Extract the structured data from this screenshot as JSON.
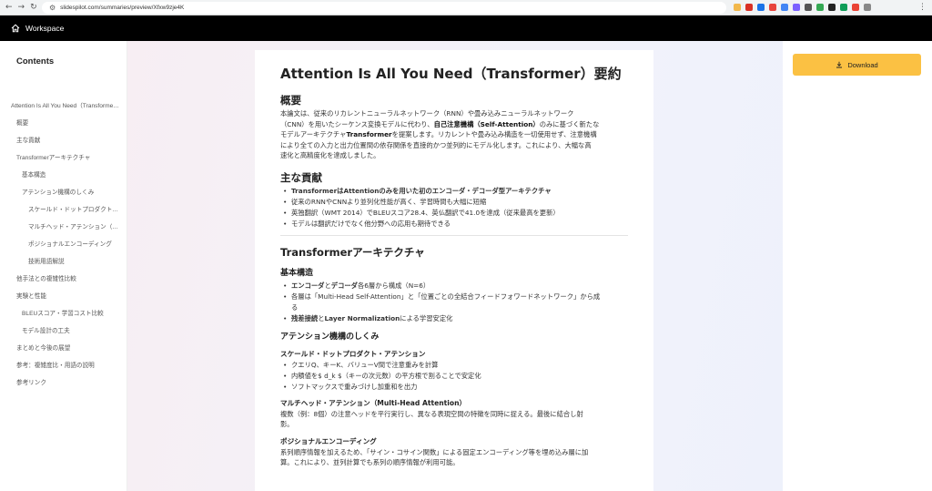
{
  "browser": {
    "url": "slidespilot.com/summaries/preview/Xfxw9zje4K"
  },
  "colors": {
    "appbar": "#000000",
    "download_button": "#fbc143"
  },
  "appbar": {
    "title": "Workspace"
  },
  "sidebar": {
    "heading": "Contents",
    "items": [
      {
        "label": "Attention Is All You Need（Transformer）要約",
        "level": 0
      },
      {
        "label": "概要",
        "level": 1
      },
      {
        "label": "主な貢献",
        "level": 1
      },
      {
        "label": "Transformerアーキテクチャ",
        "level": 1
      },
      {
        "label": "基本構造",
        "level": 2
      },
      {
        "label": "アテンション機構のしくみ",
        "level": 2
      },
      {
        "label": "スケールド・ドットプロダクト・アテンション",
        "level": 3
      },
      {
        "label": "マルチヘッド・アテンション（Multi-Head Attention）",
        "level": 3
      },
      {
        "label": "ポジショナルエンコーディング",
        "level": 3
      },
      {
        "label": "技術用語解説",
        "level": 3
      },
      {
        "label": "他手法との複雑性比較",
        "level": 1
      },
      {
        "label": "実験と性能",
        "level": 1
      },
      {
        "label": "BLEUスコア・学習コスト比較",
        "level": 2
      },
      {
        "label": "モデル設計の工夫",
        "level": 2
      },
      {
        "label": "まとめと今後の展望",
        "level": 1
      },
      {
        "label": "参考：複雑度比・用語の説明",
        "level": 1
      },
      {
        "label": "参考リンク",
        "level": 1
      }
    ]
  },
  "article": {
    "title": "Attention Is All You Need（Transformer）要約",
    "overview": {
      "heading": "概要",
      "p1": "本論文は、従来のリカレントニューラルネットワーク（RNN）や畳み込みニューラルネットワーク",
      "p2a": "（CNN）を用いたシーケンス変換モデルに代わり、",
      "p2b": "自己注意機構（Self-Attention）",
      "p2c": "のみに基づく新たな",
      "p3a": "モデルアーキテクチャ",
      "p3b": "Transformer",
      "p3c": "を提案します。リカレントや畳み込み構造を一切使用せず、注意機構",
      "p4": "により全ての入力と出力位置間の依存関係を直接的かつ並列的にモデル化します。これにより、大幅な高",
      "p5": "速化と高精度化を達成しました。"
    },
    "contrib": {
      "heading": "主な貢献",
      "b1": "TransformerはAttentionのみを用いた初のエンコーダ・デコーダ型アーキテクチャ",
      "b2": "従来のRNNやCNNより並列化性能が高く、学習時間も大幅に短縮",
      "b3": "英独翻訳（WMT 2014）でBLEUスコア28.4、英仏翻訳で41.0を達成（従来最高を更新）",
      "b4": "モデルは翻訳だけでなく他分野への応用も期待できる"
    },
    "arch": {
      "heading": "Transformerアーキテクチャ",
      "basic": {
        "heading": "基本構造",
        "b1a": "エンコーダ",
        "b1b": "と",
        "b1c": "デコーダ",
        "b1d": "各6層から構成（N=6）",
        "b2a": "各層は「Multi-Head Self-Attention」と「位置ごとの全結合フィードフォワードネットワーク」から成",
        "b2b": "る",
        "b3a": "残差接続",
        "b3b": "と",
        "b3c": "Layer Normalization",
        "b3d": "による学習安定化"
      },
      "attn": {
        "heading": "アテンション機構のしくみ",
        "sdpa": {
          "heading": "スケールド・ドットプロダクト・アテンション",
          "b1": "クエリQ、キーK、バリューV間で注意重みを計算",
          "b2": "内積値を$ d_k $（キーの次元数）の平方根で割ることで安定化",
          "b3": "ソフトマックスで重みづけし加重和を出力"
        },
        "mha": {
          "heading": "マルチヘッド・アテンション（Multi-Head Attention）",
          "p1": "複数（例：8個）の注意ヘッドを平行実行し、異なる表現空間の特徴を同時に捉える。最後に結合し射",
          "p2": "影。"
        },
        "pe": {
          "heading": "ポジショナルエンコーディング",
          "p1": "系列順序情報を加えるため、「サイン・コサイン関数」による固定エンコーディング等を埋め込み層に加",
          "p2": "算。これにより、並列計算でも系列の順序情報が利用可能。"
        }
      }
    }
  },
  "right": {
    "download_label": "Download"
  }
}
